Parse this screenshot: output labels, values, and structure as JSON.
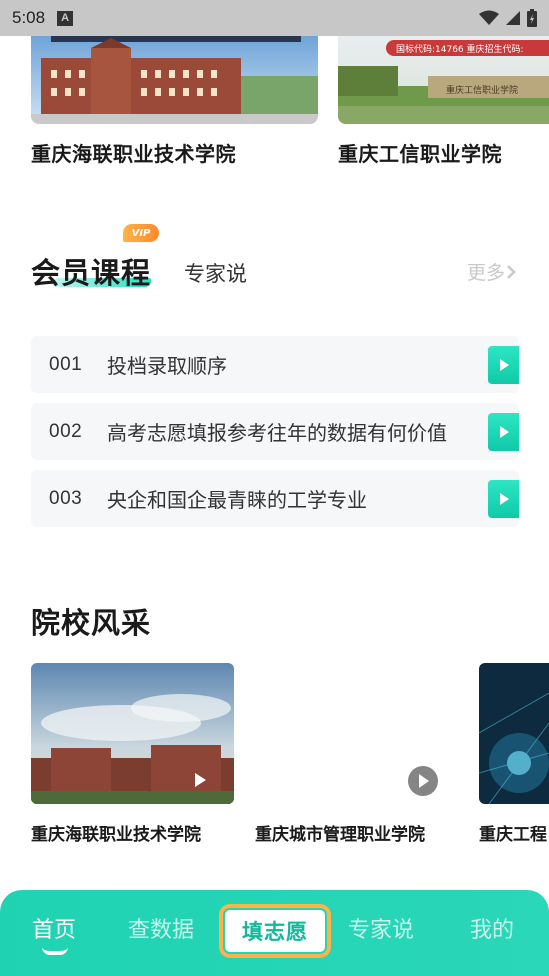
{
  "status_bar": {
    "time": "5:08",
    "notification_icon": "A"
  },
  "top_colleges": [
    {
      "name": "重庆海联职业技术学院"
    },
    {
      "name": "重庆工信职业学院",
      "banner_text": "国标代码:14766  重庆招生代码:",
      "gate_text": "重庆工信职业学院"
    }
  ],
  "member_section": {
    "vip_badge": "VIP",
    "active_tab": "会员课程",
    "other_tab": "专家说",
    "more": "更多"
  },
  "courses": [
    {
      "num": "001",
      "title": "投档录取顺序"
    },
    {
      "num": "002",
      "title": "高考志愿填报参考往年的数据有何价值"
    },
    {
      "num": "003",
      "title": "央企和国企最青睐的工学专业"
    }
  ],
  "style_section": {
    "title": "院校风采",
    "videos": [
      {
        "name": "重庆海联职业技术学院"
      },
      {
        "name": "重庆城市管理职业学院"
      },
      {
        "name": "重庆工程"
      }
    ]
  },
  "bottom_nav": {
    "home": "首页",
    "data": "查数据",
    "center": "填志愿",
    "experts": "专家说",
    "mine": "我的"
  },
  "colors": {
    "accent": "#1fd3b2",
    "vip": "#ff9a2e"
  }
}
